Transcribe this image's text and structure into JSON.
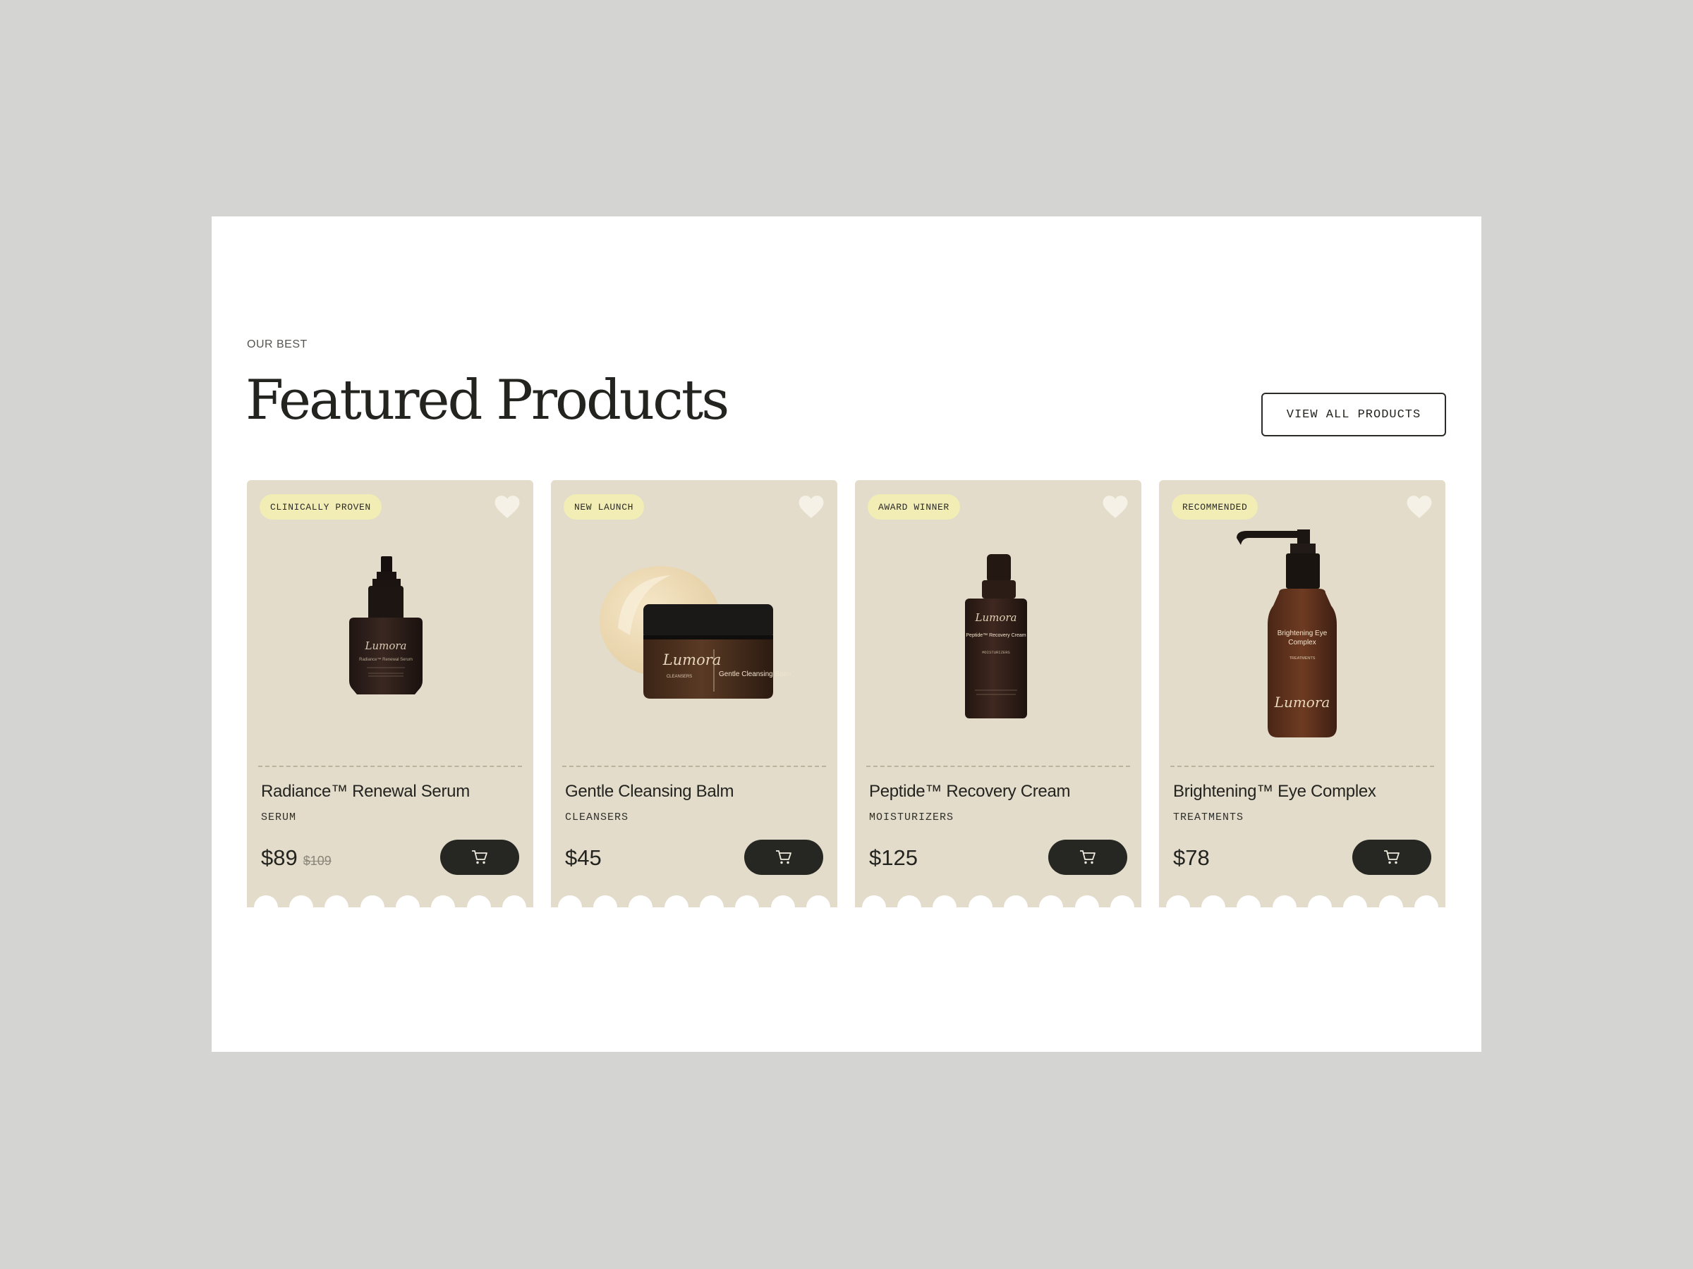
{
  "section": {
    "eyebrow": "OUR BEST",
    "title": "Featured Products",
    "view_all_label": "VIEW ALL PRODUCTS"
  },
  "colors": {
    "card_bg": "#e3dcca",
    "badge_bg": "#f2ecb5",
    "button_dark": "#262622",
    "page_bg": "#d4d4d2"
  },
  "products": [
    {
      "badge": "CLINICALLY PROVEN",
      "name": "Radiance™ Renewal Serum",
      "category": "SERUM",
      "price": "$89",
      "old_price": "$109",
      "image": {
        "icon": "serum-bottle",
        "brand": "Lumora",
        "label": "Radiance™ Renewal Serum"
      }
    },
    {
      "badge": "NEW LAUNCH",
      "name": "Gentle Cleansing Balm",
      "category": "CLEANSERS",
      "price": "$45",
      "old_price": "",
      "image": {
        "icon": "balm-jar",
        "brand": "Lumora",
        "label": "Gentle Cleansing Balm",
        "sub": "CLEANSERS"
      }
    },
    {
      "badge": "AWARD WINNER",
      "name": "Peptide™ Recovery Cream",
      "category": "MOISTURIZERS",
      "price": "$125",
      "old_price": "",
      "image": {
        "icon": "pump-bottle",
        "brand": "Lumora",
        "label": "Peptide™ Recovery Cream",
        "sub": "MOISTURIZERS"
      }
    },
    {
      "badge": "RECOMMENDED",
      "name": "Brightening™ Eye Complex",
      "category": "TREATMENTS",
      "price": "$78",
      "old_price": "",
      "image": {
        "icon": "dispenser-bottle",
        "brand": "Lumora",
        "label": "Brightening Eye Complex",
        "sub": "TREATMENTS"
      }
    }
  ]
}
